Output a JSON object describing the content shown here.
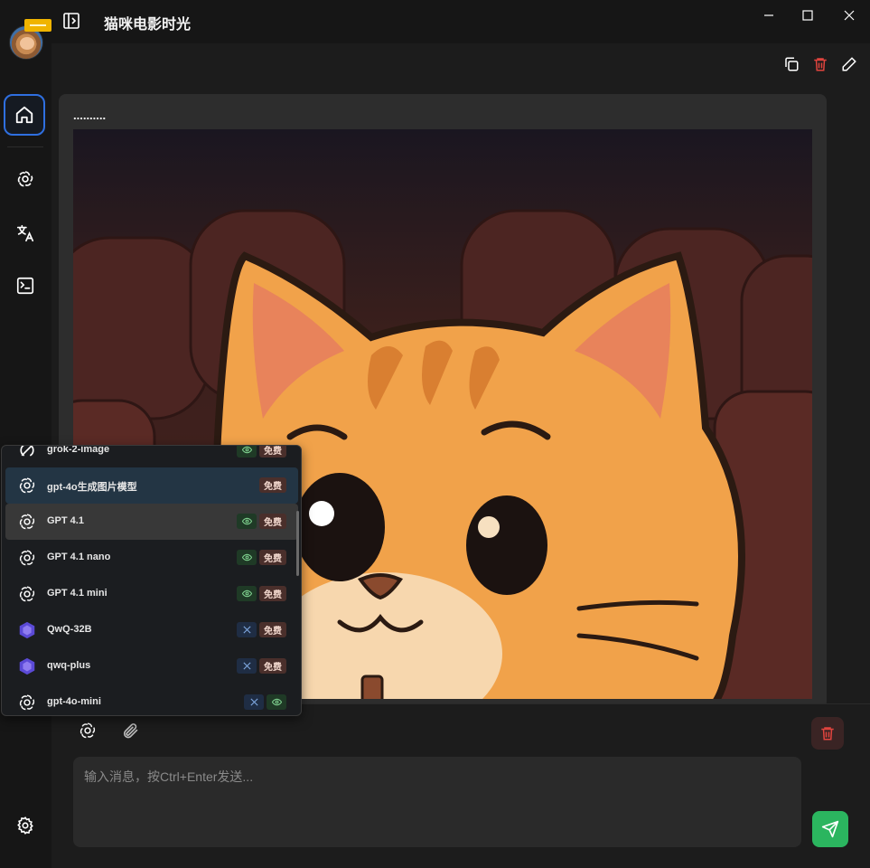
{
  "app": {
    "title": "猫咪电影时光"
  },
  "message": {
    "text": ".........."
  },
  "composer": {
    "placeholder": "输入消息，按Ctrl+Enter发送..."
  },
  "models": [
    {
      "name": "grok-2-image",
      "icon": "grok-icon",
      "tags": [
        "vision",
        "免费"
      ]
    },
    {
      "name": "gpt-4o生成图片模型",
      "icon": "openai-icon",
      "tags": [
        "免费"
      ],
      "state": "selected"
    },
    {
      "name": "GPT 4.1",
      "icon": "openai-icon",
      "tags": [
        "vision",
        "免费"
      ],
      "state": "hover"
    },
    {
      "name": "GPT 4.1 nano",
      "icon": "openai-icon",
      "tags": [
        "vision",
        "免费"
      ]
    },
    {
      "name": "GPT 4.1 mini",
      "icon": "openai-icon",
      "tags": [
        "vision",
        "免费"
      ]
    },
    {
      "name": "QwQ-32B",
      "icon": "qwen-icon",
      "tags": [
        "tool",
        "免费"
      ]
    },
    {
      "name": "qwq-plus",
      "icon": "qwen-icon",
      "tags": [
        "tool",
        "免费"
      ]
    },
    {
      "name": "gpt-4o-mini",
      "icon": "openai-icon",
      "tags": [
        "tool",
        "vision"
      ]
    }
  ],
  "colors": {
    "accent": "#2f6fe0",
    "send": "#2bb55f",
    "danger": "#e0443e",
    "free_tag": "#4a2f2b"
  }
}
